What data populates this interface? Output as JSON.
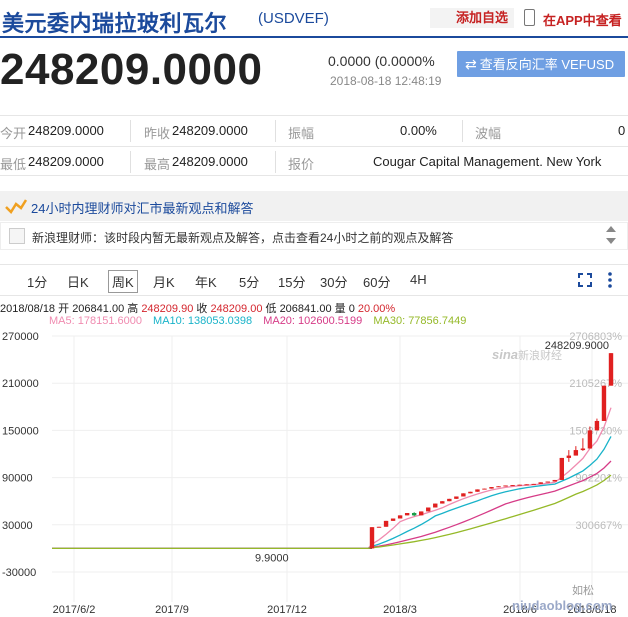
{
  "header": {
    "title": "美元委内瑞拉玻利瓦尔",
    "code": "(USDVEF)",
    "add_favorite": "添加自选",
    "view_in_app": "在APP中查看"
  },
  "quote": {
    "price": "248209.0000",
    "change": "0.0000 (0.0000%",
    "datetime": "2018-08-18 12:48:19",
    "reverse_button": "查看反向汇率 VEFUSD"
  },
  "stats": {
    "open_label": "今开",
    "open": "248209.0000",
    "prev_close_label": "昨收",
    "prev_close": "248209.0000",
    "amplitude_label": "振幅",
    "amplitude": "0.00%",
    "volatility_label": "波幅",
    "volatility": "0",
    "low_label": "最低",
    "low": "248209.0000",
    "high_label": "最高",
    "high": "248209.0000",
    "quote_label": "报价",
    "quote_source": "Cougar Capital Management. New York"
  },
  "news": {
    "band_text": "24小时内理财师对汇市最新观点和解答",
    "advisor_text": "新浪理财师：该时段内暂无最新观点及解答，点击查看24小时之前的观点及解答"
  },
  "tabs": [
    "1分",
    "日K",
    "周K",
    "月K",
    "年K",
    "5分",
    "15分",
    "30分",
    "60分",
    "4H"
  ],
  "active_tab": "周K",
  "ohlc": {
    "date": "2018/08/18",
    "open_label": "开",
    "open": "206841.00",
    "high_label": "高",
    "high": "248209.90",
    "close_label": "收",
    "close": "248209.00",
    "low_label": "低",
    "low": "206841.00",
    "vol_label": "量",
    "vol": "0",
    "pct": "20.00%"
  },
  "ma": {
    "ma5": "MA5: 178151.6000",
    "ma10": "MA10: 138053.0398",
    "ma20": "MA20: 102600.5199",
    "ma30": "MA30: 77856.7449"
  },
  "watermark": {
    "sina": "新浪财经",
    "wechat": "如松",
    "site": "niudaoblog.com"
  },
  "colors": {
    "up": "#e02020",
    "down": "#1a9e4a",
    "ma5": "#f08bb0",
    "ma10": "#19b3c9",
    "ma20": "#d63b87",
    "ma30": "#95b928",
    "brand": "#1b4a9c"
  },
  "chart_data": {
    "type": "candlestick",
    "ylim": [
      -30000,
      270000
    ],
    "y_ticks": [
      "270000",
      "210000",
      "150000",
      "90000",
      "30000",
      "-30000"
    ],
    "right_ticks": [
      "2706803%",
      "2105267%",
      "1503730%",
      "902201%",
      "300667%"
    ],
    "x_labels": [
      "2017/6/2",
      "2017/9",
      "2017/12",
      "2018/3",
      "2018/6",
      "2018/8/18"
    ],
    "max_label": "248209.9000",
    "min_label": "9.9000",
    "flat_value": 9.9,
    "candles": [
      {
        "o": 9.9,
        "h": 27000,
        "l": 9.9,
        "c": 27000
      },
      {
        "o": 27000,
        "h": 27500,
        "l": 26500,
        "c": 27500
      },
      {
        "o": 27500,
        "h": 35000,
        "l": 27500,
        "c": 35000
      },
      {
        "o": 35000,
        "h": 38000,
        "l": 35000,
        "c": 38000
      },
      {
        "o": 38000,
        "h": 42000,
        "l": 38000,
        "c": 42000
      },
      {
        "o": 42000,
        "h": 45000,
        "l": 42000,
        "c": 45000
      },
      {
        "o": 45000,
        "h": 46000,
        "l": 41000,
        "c": 42000
      },
      {
        "o": 42000,
        "h": 47000,
        "l": 42000,
        "c": 47000
      },
      {
        "o": 47000,
        "h": 52000,
        "l": 47000,
        "c": 52000
      },
      {
        "o": 52000,
        "h": 57000,
        "l": 52000,
        "c": 57000
      },
      {
        "o": 57000,
        "h": 60000,
        "l": 57000,
        "c": 60000
      },
      {
        "o": 60000,
        "h": 63000,
        "l": 60000,
        "c": 63000
      },
      {
        "o": 63000,
        "h": 66000,
        "l": 63000,
        "c": 66000
      },
      {
        "o": 66000,
        "h": 70000,
        "l": 66000,
        "c": 70000
      },
      {
        "o": 70000,
        "h": 72000,
        "l": 70000,
        "c": 72000
      },
      {
        "o": 72000,
        "h": 75000,
        "l": 72000,
        "c": 75000
      },
      {
        "o": 75000,
        "h": 76000,
        "l": 75000,
        "c": 76000
      },
      {
        "o": 76000,
        "h": 78000,
        "l": 76000,
        "c": 78000
      },
      {
        "o": 78000,
        "h": 79000,
        "l": 78000,
        "c": 79000
      },
      {
        "o": 79000,
        "h": 80000,
        "l": 79000,
        "c": 80000
      },
      {
        "o": 80000,
        "h": 80500,
        "l": 80000,
        "c": 80500
      },
      {
        "o": 80500,
        "h": 81000,
        "l": 80500,
        "c": 81000
      },
      {
        "o": 81000,
        "h": 81500,
        "l": 81000,
        "c": 81500
      },
      {
        "o": 81500,
        "h": 82000,
        "l": 81500,
        "c": 82000
      },
      {
        "o": 82000,
        "h": 84000,
        "l": 82000,
        "c": 84000
      },
      {
        "o": 84000,
        "h": 85000,
        "l": 84000,
        "c": 85000
      },
      {
        "o": 85000,
        "h": 87000,
        "l": 85000,
        "c": 87000
      },
      {
        "o": 87000,
        "h": 115000,
        "l": 87000,
        "c": 115000
      },
      {
        "o": 115000,
        "h": 125000,
        "l": 110000,
        "c": 118000
      },
      {
        "o": 118000,
        "h": 130000,
        "l": 118000,
        "c": 125000
      },
      {
        "o": 125000,
        "h": 140000,
        "l": 124000,
        "c": 127000
      },
      {
        "o": 127000,
        "h": 155000,
        "l": 127000,
        "c": 150000
      },
      {
        "o": 150000,
        "h": 165000,
        "l": 150000,
        "c": 162000
      },
      {
        "o": 162000,
        "h": 206841,
        "l": 162000,
        "c": 206841
      },
      {
        "o": 206841,
        "h": 248209.9,
        "l": 206841,
        "c": 248209
      }
    ]
  }
}
